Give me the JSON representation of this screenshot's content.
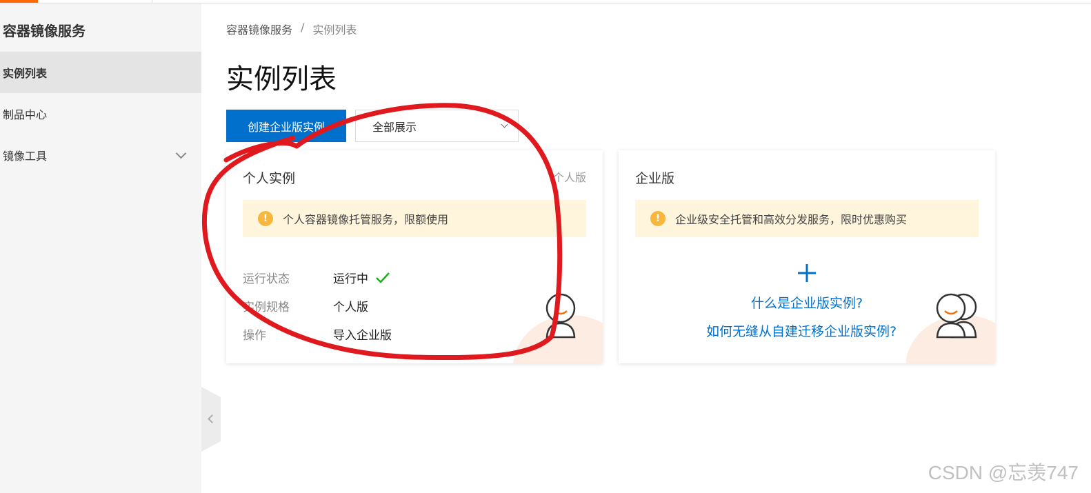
{
  "sidebar": {
    "title": "容器镜像服务",
    "items": [
      {
        "label": "实例列表",
        "active": true
      },
      {
        "label": "制品中心"
      },
      {
        "label": "镜像工具",
        "expandable": true
      }
    ]
  },
  "breadcrumb": {
    "root": "容器镜像服务",
    "separator": "/",
    "current": "实例列表"
  },
  "page": {
    "title": "实例列表"
  },
  "toolbar": {
    "create_label": "创建企业版实例",
    "filter_value": "全部展示"
  },
  "personal_card": {
    "title": "个人实例",
    "tag": "个人版",
    "notice": "个人容器镜像托管服务，限额使用",
    "fields": [
      {
        "key": "运行状态",
        "value": "运行中"
      },
      {
        "key": "实例规格",
        "value": "个人版"
      },
      {
        "key": "操作",
        "value": "导入企业版"
      }
    ]
  },
  "enterprise_card": {
    "title": "企业版",
    "notice": "企业级安全托管和高效分发服务，限时优惠购买",
    "link1": "什么是企业版实例?",
    "link2": "如何无缝从自建迁移企业版实例?"
  },
  "watermark": "CSDN @忘羡747",
  "colors": {
    "primary": "#0070cc",
    "accent": "#ff6a00",
    "warning": "#f6b73c",
    "success": "#1aad19",
    "annotation": "#e0191e"
  },
  "icons": {
    "warning": "exclamation-circle-icon",
    "status": "check-icon",
    "add": "plus-icon",
    "avatar": "user-avatar-icon"
  }
}
